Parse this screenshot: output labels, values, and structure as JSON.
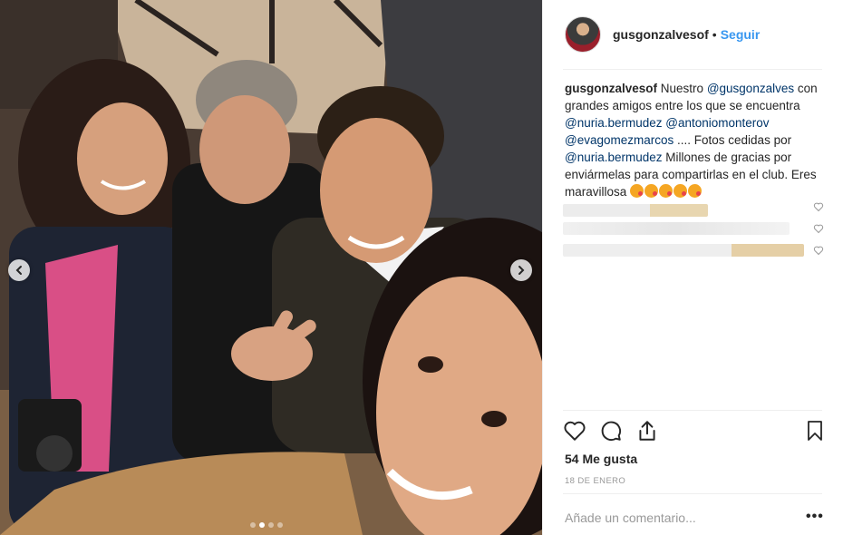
{
  "post": {
    "username": "gusgonzalvesof",
    "separator": "•",
    "follow_label": "Seguir"
  },
  "caption": {
    "username": "gusgonzalvesof",
    "t1": "Nuestro",
    "m1": "@gusgonzalves",
    "t2": "con grandes amigos entre los que se encuentra",
    "m2": "@nuria.bermudez",
    "m3": "@antoniomonterov",
    "m4": "@evagomezmarcos",
    "t3": ".... Fotos cedidas por",
    "m5": "@nuria.bermudez",
    "t4": "Millones de gracias por enviármelas para compartirlas en el club. Eres maravillosa"
  },
  "likes_label": "54 Me gusta",
  "date_label": "18 DE ENERO",
  "comment_placeholder": "Añade un comentario...",
  "more_label": "•••",
  "icons": {
    "prev": "chevron-left-icon",
    "next": "chevron-right-icon",
    "like": "heart-icon",
    "comment": "comment-bubble-icon",
    "share": "share-icon",
    "save": "bookmark-icon"
  },
  "carousel": {
    "total": 4,
    "active_index": 1
  },
  "colors": {
    "link": "#3897f0",
    "mention": "#003569",
    "text": "#262626",
    "muted": "#999999"
  }
}
